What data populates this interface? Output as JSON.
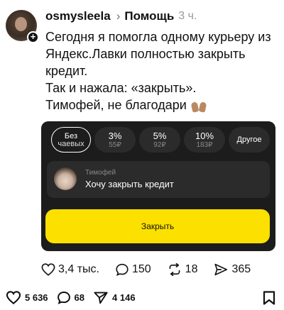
{
  "post": {
    "username": "osmysleela",
    "separator": "›",
    "topic": "Помощь",
    "time": "3 ч.",
    "paragraph1": "Сегодня я помогла одному курьеру из Яндекс.Лавки полностью закрыть кредит.",
    "paragraph2": "Так и нажала: «закрыть».",
    "paragraph3": "Тимофей, не благодари",
    "emoji": "raising-hands-emoji"
  },
  "card": {
    "tips": [
      {
        "label": "Без",
        "sub": "чаевых",
        "selected": true
      },
      {
        "label": "3%",
        "sub": "55₽"
      },
      {
        "label": "5%",
        "sub": "92₽"
      },
      {
        "label": "10%",
        "sub": "183₽"
      },
      {
        "label": "Другое"
      }
    ],
    "message": {
      "name": "Тимофей",
      "text": "Хочу закрыть кредит"
    },
    "button_label": "Закрыть",
    "accent_color": "#fce000"
  },
  "stats": {
    "likes": "3,4 тыс.",
    "comments": "150",
    "reposts": "18",
    "shares": "365"
  },
  "bottom": {
    "likes": "5 636",
    "comments": "68",
    "shares": "4 146"
  }
}
